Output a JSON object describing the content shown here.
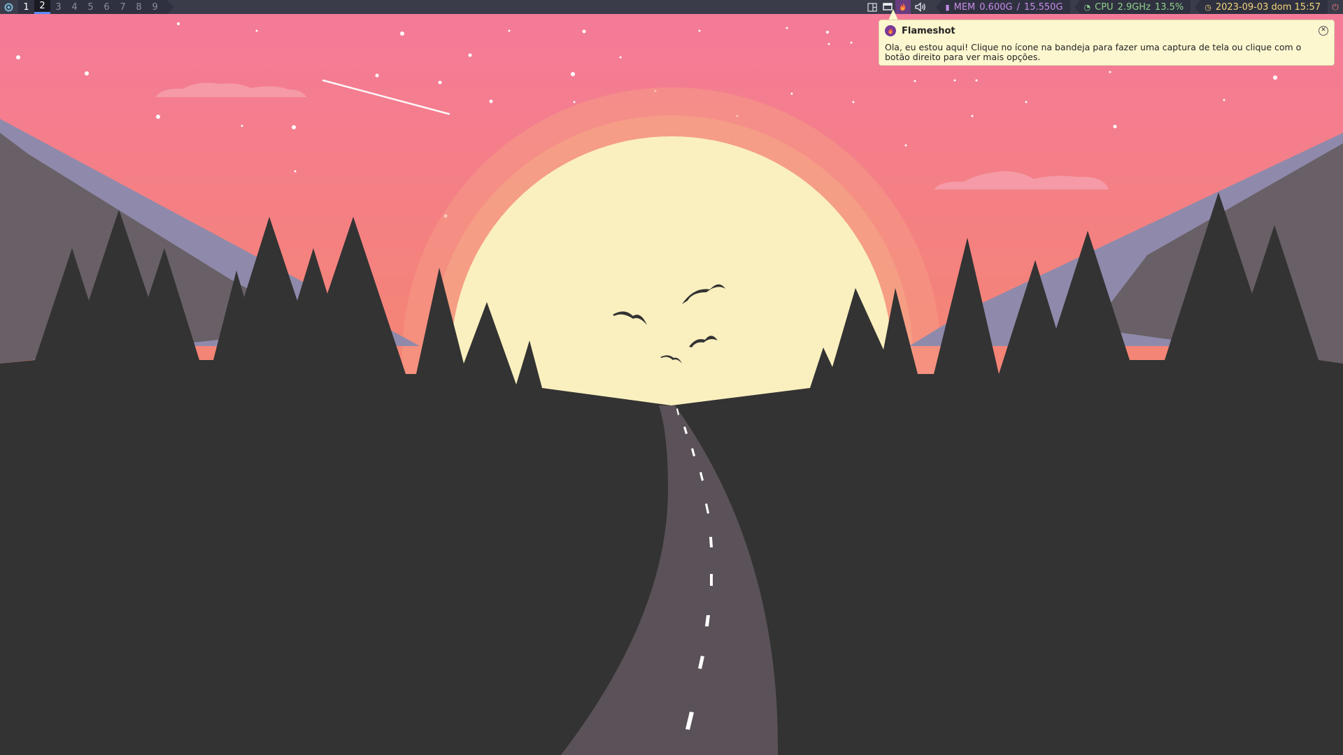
{
  "topbar": {
    "launcher_icon": "distro-logo-icon",
    "workspaces": [
      {
        "label": "1"
      },
      {
        "label": "2"
      },
      {
        "label": "3"
      },
      {
        "label": "4"
      },
      {
        "label": "5"
      },
      {
        "label": "6"
      },
      {
        "label": "7"
      },
      {
        "label": "8"
      },
      {
        "label": "9"
      }
    ],
    "active_workspace": "2",
    "tray_icons": [
      "layout-icon",
      "screen-icon",
      "flameshot-icon",
      "volume-icon"
    ],
    "mem": {
      "label": "MEM",
      "used": "0.600G",
      "separator": "/",
      "total": "15.550G"
    },
    "cpu": {
      "label": "CPU",
      "freq": "2.9GHz",
      "usage": "13.5%"
    },
    "clock": {
      "datetime": "2023-09-03 dom 15:57"
    },
    "colors": {
      "bar_bg": "#3a3c4a",
      "mem": "#c78ce8",
      "cpu": "#8fd28a",
      "clock": "#f4d57a",
      "accent": "#5e8cff"
    }
  },
  "notification": {
    "app_icon": "flameshot-icon",
    "title": "Flameshot",
    "body": "Ola, eu estou aqui! Clique no ícone na bandeja para fazer uma captura de tela ou clique com o botão direito para ver mais opções.",
    "close_icon": "close-icon",
    "bg_color": "#fdf7d0"
  },
  "wallpaper": {
    "theme": "sunset-road-forest",
    "colors": {
      "sky_top": "#f47a9a",
      "sky_bottom": "#f59068",
      "sun": "#faf0bf",
      "mountains": "#8f8aab",
      "trees": "#333333",
      "road": "#5a5258"
    }
  }
}
